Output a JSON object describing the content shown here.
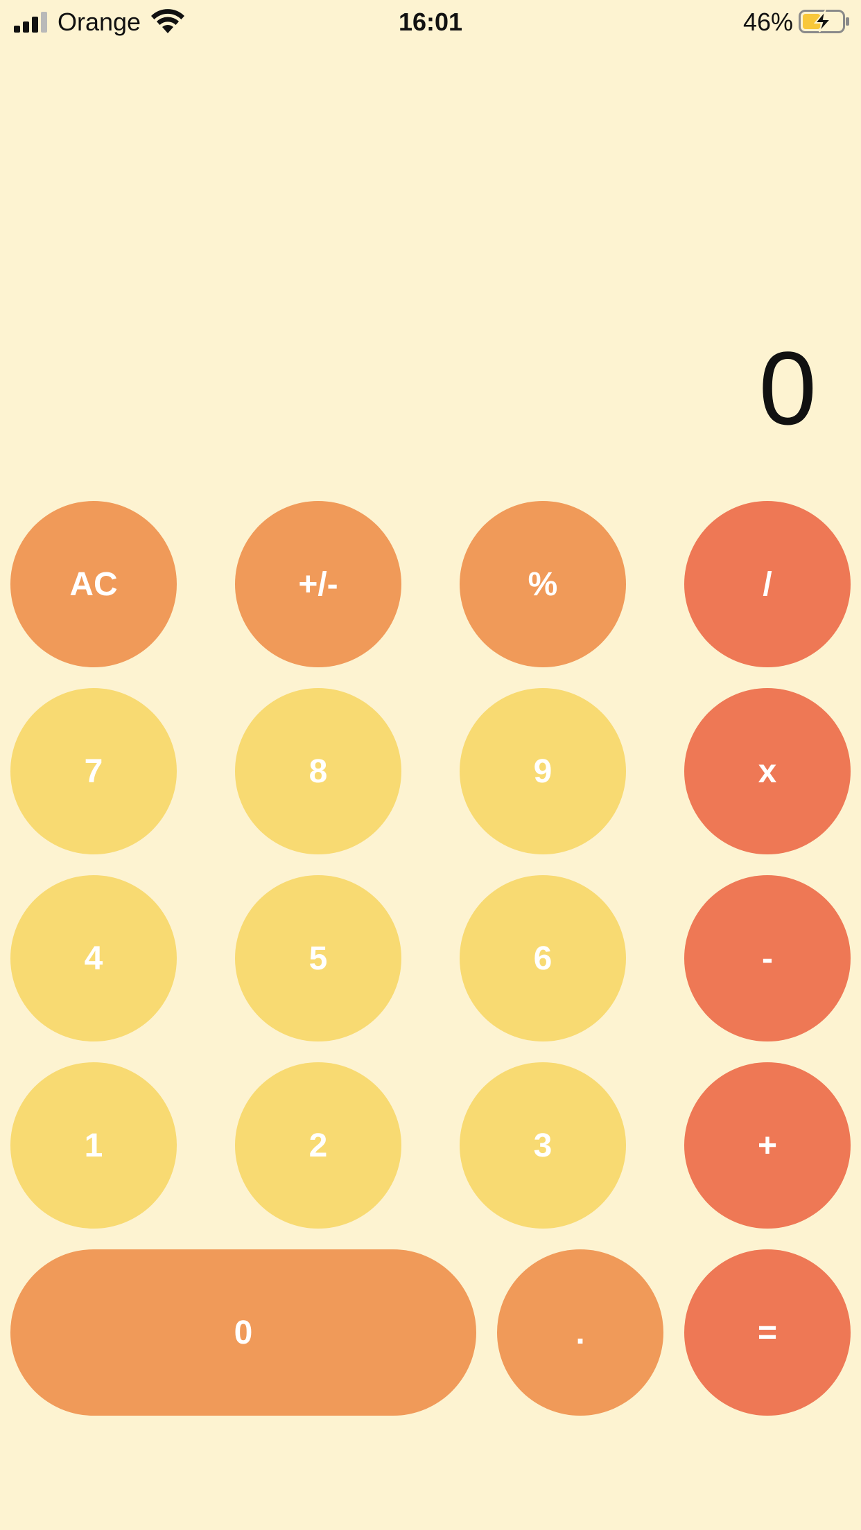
{
  "status_bar": {
    "carrier": "Orange",
    "time": "16:01",
    "battery_percent": "46%",
    "battery_level": 0.46,
    "signal_bars": 3,
    "signal_max": 4,
    "charging": true
  },
  "display": {
    "value": "0"
  },
  "keypad": {
    "row1": [
      "AC",
      "+/-",
      "%",
      "/"
    ],
    "row2": [
      "7",
      "8",
      "9",
      "x"
    ],
    "row3": [
      "4",
      "5",
      "6",
      "-"
    ],
    "row4": [
      "1",
      "2",
      "3",
      "+"
    ],
    "row5": [
      "0",
      ".",
      "="
    ]
  },
  "colors": {
    "background": "#fdf3d1",
    "function_key": "#f09a59",
    "number_key": "#f8da72",
    "operator_key": "#ee7855",
    "key_text": "#ffffff",
    "battery_charge": "#f8c73a"
  },
  "icons": {
    "signal": "cellular-signal-icon",
    "wifi": "wifi-icon",
    "battery": "battery-charging-icon"
  }
}
